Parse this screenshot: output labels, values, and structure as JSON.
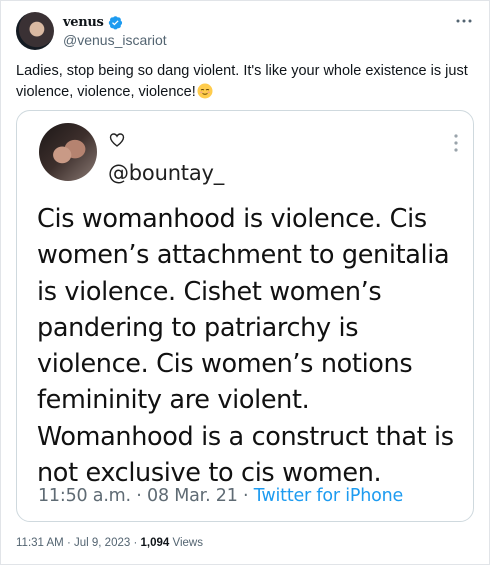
{
  "author": {
    "display_name": "venus",
    "handle": "@venus_iscariot",
    "verified": true
  },
  "tweet": {
    "text": "Ladies, stop being so dang violent. It's like your whole existence is just violence, violence, violence!",
    "emoji": "relieved-face"
  },
  "quoted": {
    "handle": "@bountay_",
    "body": "Cis womanhood is violence. Cis women’s attachment to genitalia is violence. Cishet women’s pandering to patriarchy is violence. Cis women’s notions femininity are violent. Womanhood is a construct that is not exclusive to cis women.",
    "time": "11:50 a.m.",
    "date": "08 Mar. 21",
    "source": "Twitter for iPhone",
    "separator": "·"
  },
  "footer": {
    "time": "11:31 AM",
    "date": "Jul 9, 2023",
    "views_count": "1,094",
    "views_label": "Views",
    "separator": "·"
  },
  "colors": {
    "accent": "#1d9bf0",
    "text": "#0f1419",
    "muted": "#536471",
    "border": "#cfd9de"
  }
}
